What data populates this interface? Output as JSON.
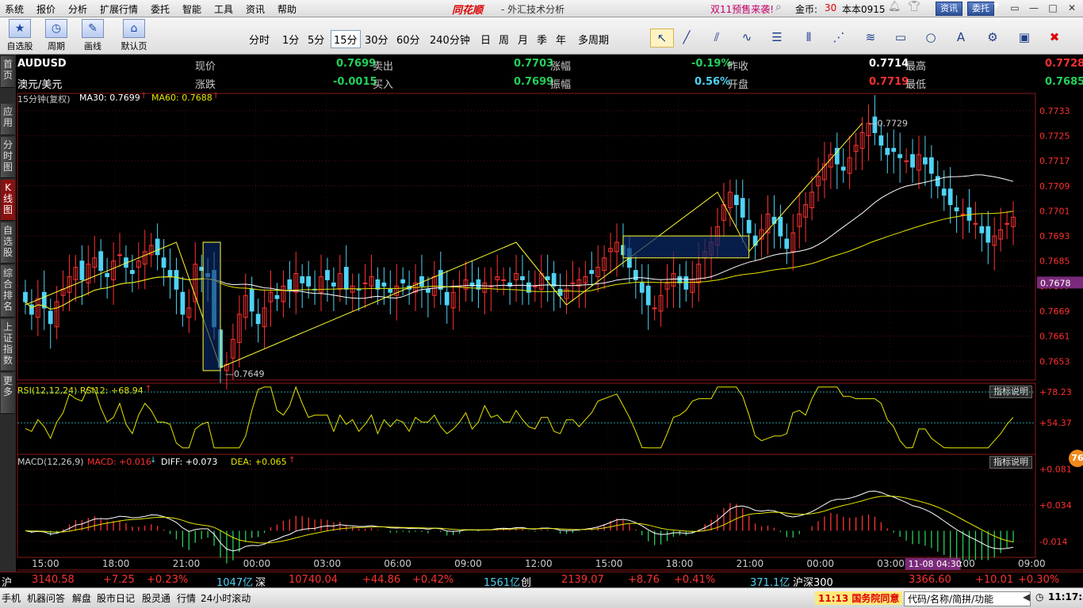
{
  "menu": [
    "系统",
    "报价",
    "分析",
    "扩展行情",
    "委托",
    "智能",
    "工具",
    "资讯",
    "帮助"
  ],
  "brand": "同花顺",
  "app_title": "- 外汇技术分析",
  "promo": "双11预售来袭!",
  "coins_label": "金币:",
  "coins_value": "30",
  "user": "本本0915",
  "news_btn": "资讯",
  "trade_btn": "委托",
  "toolbar": {
    "buttons": [
      {
        "label": "自选股",
        "icon": "star-icon"
      },
      {
        "label": "周期",
        "icon": "clock-icon"
      },
      {
        "label": "画线",
        "icon": "pen-icon"
      },
      {
        "label": "默认页",
        "icon": "home-icon"
      }
    ],
    "periods": [
      "分时",
      "1分",
      "5分",
      "15分",
      "30分",
      "60分",
      "240分钟",
      "日",
      "周",
      "月",
      "季",
      "年",
      "多周期"
    ],
    "active_period": "15分"
  },
  "left_tabs": [
    "首页",
    "应用",
    "分时图",
    "K线图",
    "自选股",
    "综合排名",
    "上证指数",
    "更多"
  ],
  "quote": {
    "symbol": "AUDUSD",
    "name": "澳元/美元",
    "price_label": "现价",
    "price": "0.7699",
    "sell_label": "卖出",
    "sell": "0.7703",
    "pct_label": "涨幅",
    "pct": "-0.19%",
    "prev_label": "昨收",
    "prev": "0.7714",
    "high_label": "最高",
    "high": "0.7728",
    "chg_label": "涨跌",
    "chg": "-0.0015",
    "buy_label": "买入",
    "buy": "0.7699",
    "amp_label": "振幅",
    "amp": "0.56%",
    "open_label": "开盘",
    "open": "0.7719",
    "low_label": "最低",
    "low": "0.7685"
  },
  "main_legend": {
    "period": "15分钟(复权)",
    "ma30": "MA30: 0.7699",
    "ma60": "MA60: 0.7688"
  },
  "rsi_legend": "RSI(12,12,24)  RSI12: +68.94",
  "macd_legend": {
    "name": "MACD(12,26,9)",
    "macd": "MACD: +0.016",
    "diff": "DIFF: +0.073",
    "dea": "DEA: +0.065"
  },
  "indicator_btn": "指标说明",
  "annotations": {
    "peak": "0.7729",
    "trough": "0.7649",
    "current": "0.7678",
    "cursor_time": "11-08 04:30",
    "badge": "76"
  },
  "chart_data": {
    "type": "candlestick",
    "y_ticks": [
      "0.7733",
      "0.7725",
      "0.7717",
      "0.7709",
      "0.7701",
      "0.7693",
      "0.7685",
      "0.7677",
      "0.7669",
      "0.7661",
      "0.7653"
    ],
    "ylim": [
      0.7647,
      0.7736
    ],
    "x_ticks": [
      "15:00",
      "18:00",
      "21:00",
      "00:00",
      "03:00",
      "06:00",
      "09:00",
      "12:00",
      "15:00",
      "18:00",
      "21:00",
      "00:00",
      "03:00",
      "06:00",
      "09:00"
    ],
    "close": [
      0.7672,
      0.7668,
      0.7673,
      0.767,
      0.7665,
      0.7672,
      0.7676,
      0.768,
      0.7683,
      0.7679,
      0.7684,
      0.7686,
      0.7682,
      0.768,
      0.7685,
      0.7687,
      0.7683,
      0.7681,
      0.7685,
      0.7688,
      0.769,
      0.7687,
      0.7683,
      0.768,
      0.7676,
      0.7668,
      0.767,
      0.7684,
      0.7682,
      0.768,
      0.7664,
      0.7651,
      0.7652,
      0.766,
      0.7668,
      0.7674,
      0.7669,
      0.7665,
      0.767,
      0.7675,
      0.7673,
      0.7677,
      0.7676,
      0.7681,
      0.7678,
      0.7677,
      0.7676,
      0.768,
      0.7679,
      0.7677,
      0.7681,
      0.7676,
      0.7677,
      0.7676,
      0.7678,
      0.768,
      0.7676,
      0.7677,
      0.7675,
      0.7677,
      0.7678,
      0.7676,
      0.7678,
      0.7677,
      0.7675,
      0.768,
      0.7676,
      0.7671,
      0.7675,
      0.7677,
      0.7679,
      0.7677,
      0.7676,
      0.7678,
      0.7677,
      0.768,
      0.7679,
      0.7677,
      0.7681,
      0.7679,
      0.7675,
      0.7677,
      0.7681,
      0.7679,
      0.7677,
      0.7674,
      0.7676,
      0.7678,
      0.7679,
      0.768,
      0.7681,
      0.7683,
      0.7686,
      0.7689,
      0.7691,
      0.7687,
      0.7683,
      0.7679,
      0.7675,
      0.7671,
      0.767,
      0.7674,
      0.7678,
      0.7681,
      0.7678,
      0.7676,
      0.7679,
      0.7684,
      0.7688,
      0.7691,
      0.7696,
      0.7703,
      0.7707,
      0.7703,
      0.7699,
      0.7694,
      0.769,
      0.7695,
      0.77,
      0.7697,
      0.7693,
      0.7689,
      0.7694,
      0.77,
      0.7703,
      0.7707,
      0.7712,
      0.7716,
      0.7719,
      0.7716,
      0.7714,
      0.7718,
      0.7722,
      0.7726,
      0.7729,
      0.7726,
      0.7722,
      0.7719,
      0.772,
      0.7718,
      0.7717,
      0.7715,
      0.7719,
      0.7716,
      0.7713,
      0.7709,
      0.7706,
      0.7703,
      0.7701,
      0.77,
      0.7698,
      0.7697,
      0.7694,
      0.7691,
      0.7693,
      0.7695,
      0.7697,
      0.7699
    ],
    "ma_color_1": "#ffffff",
    "ma_color_2": "#e6e600",
    "up_color": "#ff3232",
    "down_color": "#4fd3f5",
    "rsi_ticks": [
      "+78.23",
      "+54.37"
    ],
    "macd_ticks": [
      "+0.081",
      "+0.034",
      "-0.014"
    ]
  }
}
